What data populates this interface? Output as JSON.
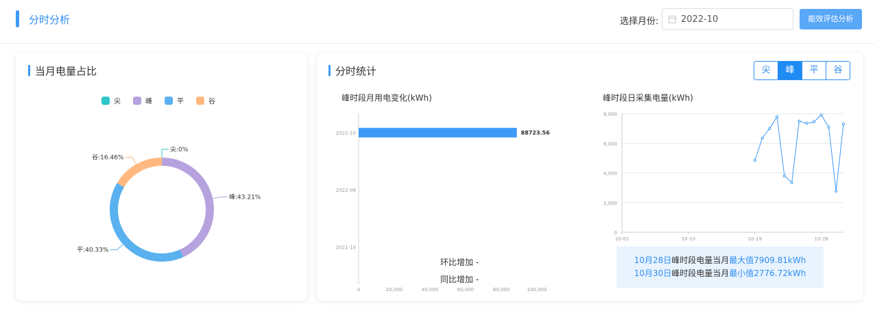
{
  "header": {
    "title": "分时分析",
    "month_label": "选择月份:",
    "month_value": "2022-10",
    "eval_button": "能效评估分析"
  },
  "left_card": {
    "title": "当月电量占比",
    "legend": [
      {
        "label": "尖",
        "color": "#2ec7c9"
      },
      {
        "label": "峰",
        "color": "#b6a2de"
      },
      {
        "label": "平",
        "color": "#5ab1ef"
      },
      {
        "label": "谷",
        "color": "#ffb980"
      }
    ]
  },
  "right_card": {
    "title": "分时统计",
    "tabs": [
      {
        "label": "尖",
        "active": false
      },
      {
        "label": "峰",
        "active": true
      },
      {
        "label": "平",
        "active": false
      },
      {
        "label": "谷",
        "active": false
      }
    ],
    "bar_chart_title": "峰时段月用电变化(kWh)",
    "line_chart_title": "峰时段日采集电量(kWh)",
    "mom_label": "环比增加 -",
    "yoy_label": "同比增加 -",
    "max_info": {
      "date": "10月28日",
      "text": "峰时段电量当月",
      "label": "最大值7909.81kWh"
    },
    "min_info": {
      "date": "10月30日",
      "text": "峰时段电量当月",
      "label": "最小值2776.72kWh"
    }
  },
  "chart_data": [
    {
      "type": "pie",
      "donut": true,
      "categories": [
        "尖",
        "峰",
        "平",
        "谷"
      ],
      "values": [
        0,
        43.21,
        40.33,
        16.46
      ],
      "labels": [
        "尖:0%",
        "峰:43.21%",
        "平:40.33%",
        "谷:16.46%"
      ],
      "colors": [
        "#2ec7c9",
        "#b6a2de",
        "#5ab1ef",
        "#ffb980"
      ],
      "legend": "top-center"
    },
    {
      "type": "bar",
      "orientation": "horizontal",
      "categories": [
        "2022-10",
        "2022-09",
        "2021-10"
      ],
      "values": [
        88723.56,
        0,
        0
      ],
      "value_labels": [
        "88723.56",
        "",
        ""
      ],
      "xlim": [
        0,
        100000
      ],
      "x_ticks": [
        0,
        20000,
        40000,
        60000,
        80000,
        100000
      ],
      "x_tick_labels": [
        "0",
        "20,000",
        "40,000",
        "60,000",
        "80,000",
        "100,000"
      ],
      "color": "#3d9af6"
    },
    {
      "type": "line",
      "x_tick_labels": [
        "10-01",
        "10-10",
        "10-19",
        "10-28"
      ],
      "x_tick_days": [
        1,
        10,
        19,
        28
      ],
      "xlim": [
        1,
        31
      ],
      "ylim": [
        0,
        8000
      ],
      "y_ticks": [
        0,
        2000,
        4000,
        6000,
        8000
      ],
      "y_tick_labels": [
        "0",
        "2,000",
        "4,000",
        "6,000",
        "8,000"
      ],
      "points": [
        {
          "day": 19,
          "value": 4850
        },
        {
          "day": 20,
          "value": 6350
        },
        {
          "day": 21,
          "value": 7000
        },
        {
          "day": 22,
          "value": 7800
        },
        {
          "day": 23,
          "value": 3800
        },
        {
          "day": 24,
          "value": 3350
        },
        {
          "day": 25,
          "value": 7500
        },
        {
          "day": 26,
          "value": 7350
        },
        {
          "day": 27,
          "value": 7450
        },
        {
          "day": 28,
          "value": 7909.81
        },
        {
          "day": 29,
          "value": 7100
        },
        {
          "day": 30,
          "value": 2776.72
        },
        {
          "day": 31,
          "value": 7300
        }
      ],
      "color": "#3d9af6",
      "grid": true
    }
  ]
}
